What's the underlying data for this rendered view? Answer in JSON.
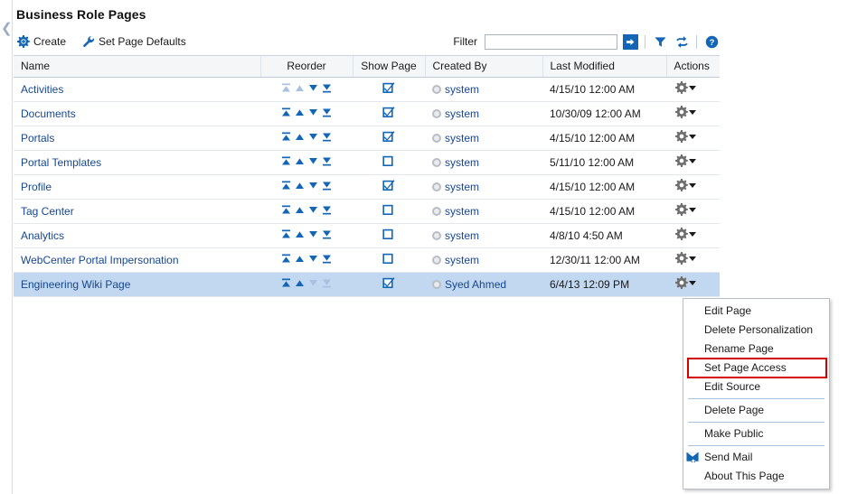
{
  "page": {
    "title": "Business Role Pages",
    "collapse_icon": "chevron-left-icon"
  },
  "toolbar": {
    "create_label": "Create",
    "create_icon": "gear-plus-icon",
    "defaults_label": "Set Page Defaults",
    "defaults_icon": "wrench-icon",
    "filter_label": "Filter",
    "filter_value": "",
    "filter_placeholder": "",
    "go_icon": "arrow-right-icon",
    "query_icon": "funnel-icon",
    "detach_icon": "detach-arrows-icon",
    "help_icon": "help-question-icon"
  },
  "table": {
    "columns": [
      "Name",
      "Reorder",
      "Show Page",
      "Created By",
      "Last Modified",
      "Actions"
    ],
    "rows": [
      {
        "name": "Activities",
        "show_page": true,
        "created_by": "system",
        "last_modified": "4/15/10 12:00 AM",
        "reorder": {
          "top": false,
          "up": false,
          "down": true,
          "bottom": true
        },
        "selected": false
      },
      {
        "name": "Documents",
        "show_page": true,
        "created_by": "system",
        "last_modified": "10/30/09 12:00 AM",
        "reorder": {
          "top": true,
          "up": true,
          "down": true,
          "bottom": true
        },
        "selected": false
      },
      {
        "name": "Portals",
        "show_page": true,
        "created_by": "system",
        "last_modified": "4/15/10 12:00 AM",
        "reorder": {
          "top": true,
          "up": true,
          "down": true,
          "bottom": true
        },
        "selected": false
      },
      {
        "name": "Portal Templates",
        "show_page": false,
        "created_by": "system",
        "last_modified": "5/11/10 12:00 AM",
        "reorder": {
          "top": true,
          "up": true,
          "down": true,
          "bottom": true
        },
        "selected": false
      },
      {
        "name": "Profile",
        "show_page": true,
        "created_by": "system",
        "last_modified": "4/15/10 12:00 AM",
        "reorder": {
          "top": true,
          "up": true,
          "down": true,
          "bottom": true
        },
        "selected": false
      },
      {
        "name": "Tag Center",
        "show_page": false,
        "created_by": "system",
        "last_modified": "4/15/10 12:00 AM",
        "reorder": {
          "top": true,
          "up": true,
          "down": true,
          "bottom": true
        },
        "selected": false
      },
      {
        "name": "Analytics",
        "show_page": false,
        "created_by": "system",
        "last_modified": "4/8/10 4:50 AM",
        "reorder": {
          "top": true,
          "up": true,
          "down": true,
          "bottom": true
        },
        "selected": false
      },
      {
        "name": "WebCenter Portal Impersonation",
        "show_page": false,
        "created_by": "system",
        "last_modified": "12/30/11 12:00 AM",
        "reorder": {
          "top": true,
          "up": true,
          "down": true,
          "bottom": true
        },
        "selected": false
      },
      {
        "name": "Engineering Wiki Page",
        "show_page": true,
        "created_by": "Syed Ahmed",
        "last_modified": "6/4/13 12:09 PM",
        "reorder": {
          "top": true,
          "up": true,
          "down": false,
          "bottom": false
        },
        "selected": true
      }
    ]
  },
  "context_menu": {
    "items": [
      {
        "label": "Edit Page",
        "highlighted": false,
        "icon": null,
        "separator_before": false
      },
      {
        "label": "Delete Personalization",
        "highlighted": false,
        "icon": null,
        "separator_before": false
      },
      {
        "label": "Rename Page",
        "highlighted": false,
        "icon": null,
        "separator_before": false
      },
      {
        "label": "Set Page Access",
        "highlighted": true,
        "icon": null,
        "separator_before": false
      },
      {
        "label": "Edit Source",
        "highlighted": false,
        "icon": null,
        "separator_before": false
      },
      {
        "label": "Delete Page",
        "highlighted": false,
        "icon": null,
        "separator_before": true
      },
      {
        "label": "Make Public",
        "highlighted": false,
        "icon": null,
        "separator_before": true
      },
      {
        "label": "Send Mail",
        "highlighted": false,
        "icon": "envelope-icon",
        "separator_before": true
      },
      {
        "label": "About This Page",
        "highlighted": false,
        "icon": null,
        "separator_before": false
      }
    ]
  },
  "colors": {
    "accent_blue": "#1266b5",
    "link_blue": "#17478f",
    "selected_row": "#c2d7f0",
    "highlight_red": "#d40000",
    "header_bg": "#f4f6f8"
  }
}
